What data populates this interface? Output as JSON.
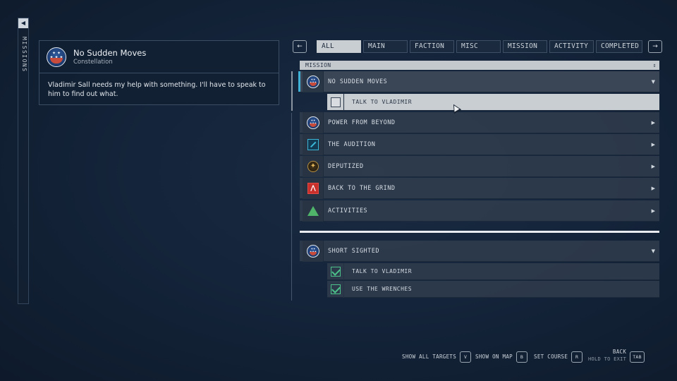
{
  "sidebar": {
    "label": "MISSIONS",
    "back_icon": "triangle-left-icon"
  },
  "detail": {
    "title": "No Sudden Moves",
    "faction": "Constellation",
    "description": "Vladimir Sall needs my help with something. I'll have to speak to him to find out what."
  },
  "tabs": {
    "prev_arrow": "←",
    "next_arrow": "→",
    "items": [
      "ALL",
      "MAIN",
      "FACTION",
      "MISC",
      "MISSION",
      "ACTIVITY",
      "COMPLETED"
    ],
    "active": "ALL"
  },
  "list": {
    "header": "MISSION",
    "sort_icon": "⇕",
    "missions": [
      {
        "label": "NO SUDDEN MOVES",
        "icon": "constellation-icon",
        "expanded": true,
        "chevron": "▼"
      },
      {
        "label": "POWER FROM BEYOND",
        "icon": "constellation-icon",
        "chevron": "▶"
      },
      {
        "label": "THE AUDITION",
        "icon": "audition-icon",
        "chevron": "▶"
      },
      {
        "label": "DEPUTIZED",
        "icon": "deputized-icon",
        "chevron": "▶"
      },
      {
        "label": "BACK TO THE GRIND",
        "icon": "grind-icon",
        "chevron": "▶"
      },
      {
        "label": "ACTIVITIES",
        "icon": "activities-icon",
        "chevron": "▶"
      }
    ],
    "objectives": [
      {
        "label": "TALK TO VLADIMIR",
        "checked": false
      }
    ],
    "completed_mission": {
      "label": "SHORT SIGHTED",
      "icon": "constellation-icon",
      "chevron": "▼"
    },
    "completed_objectives": [
      {
        "label": "TALK TO VLADIMIR",
        "checked": true
      },
      {
        "label": "USE THE WRENCHES",
        "checked": true
      }
    ]
  },
  "footer": {
    "show_all_targets": "SHOW ALL TARGETS",
    "show_all_key": "V",
    "show_on_map": "SHOW ON MAP",
    "show_on_map_key": "B",
    "set_course": "SET COURSE",
    "set_course_key": "R",
    "back": "BACK",
    "hold_to_exit": "HOLD TO EXIT",
    "back_key": "TAB"
  },
  "colors": {
    "accent": "#3fb1d6",
    "check": "#4cc28a",
    "background": "#14243a"
  }
}
